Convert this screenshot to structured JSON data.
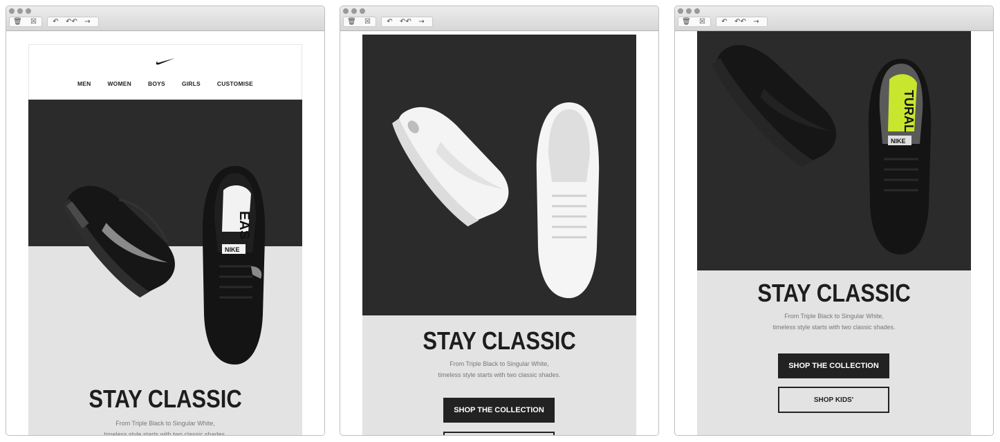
{
  "toolbar": {
    "trash_icon": "trash-icon",
    "junk_icon": "junk-icon",
    "reply_icon": "reply-icon",
    "reply_all_icon": "reply-all-icon",
    "forward_icon": "forward-icon"
  },
  "email": {
    "nav": [
      "MEN",
      "WOMEN",
      "BOYS",
      "GIRLS",
      "CUSTOMISE"
    ],
    "headline": "STAY CLASSIC",
    "sub_line1": "From Triple Black to Singular White,",
    "sub_line2": "timeless style starts with two classic shades.",
    "primary_cta": "SHOP THE COLLECTION",
    "secondary_cta": "SHOP KIDS'",
    "shoe_text_1": "EAS",
    "shoe_text_2": "NIKE",
    "shoe_text_3": "TURAL"
  },
  "colors": {
    "dark_band": "#2b2b2b",
    "grey_band": "#e3e3e3",
    "accent_volt": "#c8e62e"
  }
}
